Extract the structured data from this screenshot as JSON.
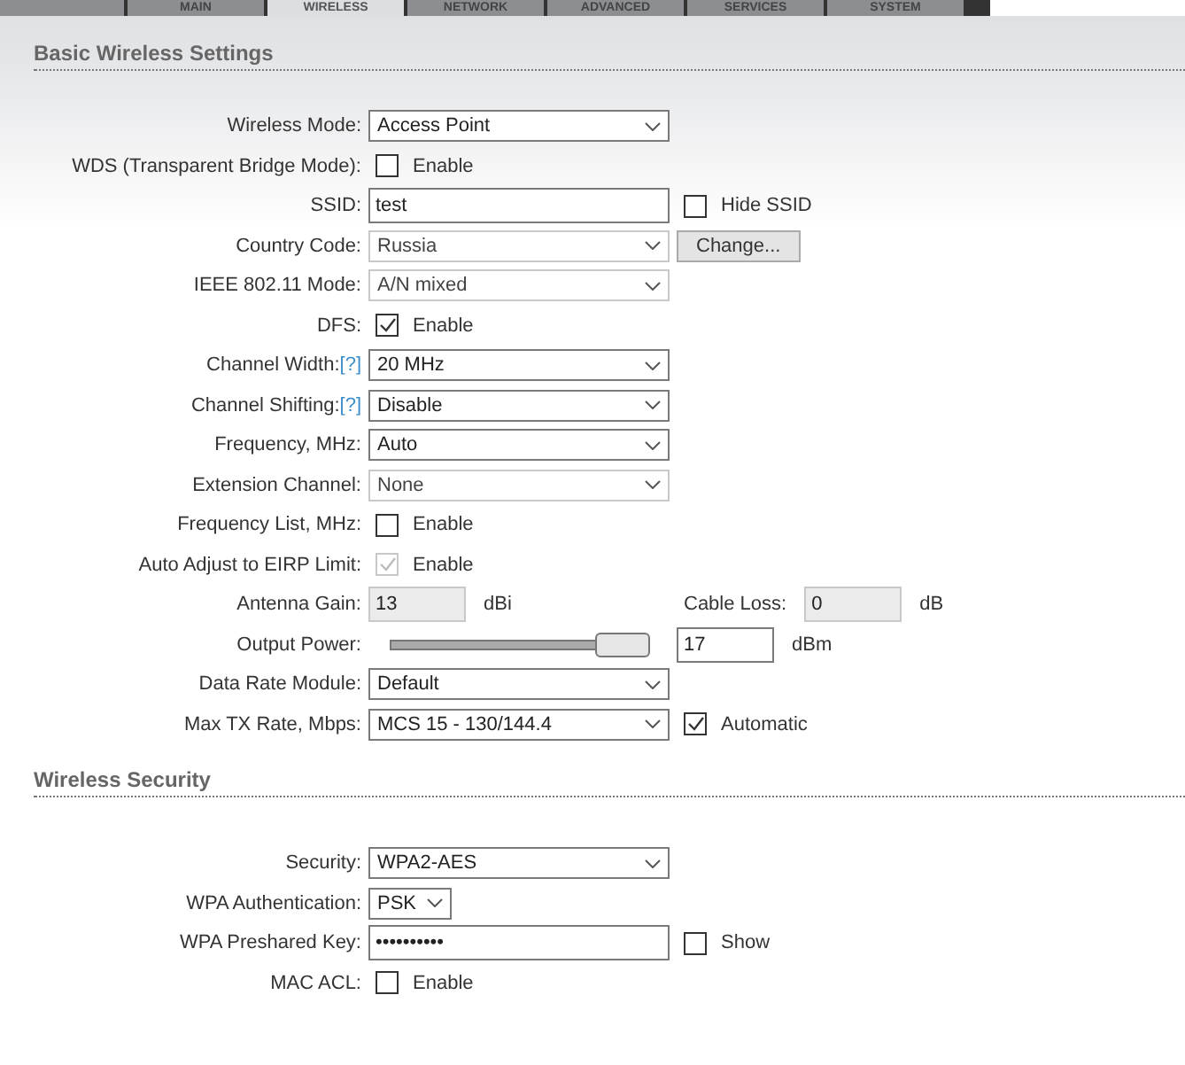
{
  "tabs": [
    {
      "kind": "icon",
      "selected": false
    },
    {
      "kind": "text",
      "label": "MAIN",
      "selected": false
    },
    {
      "kind": "text",
      "label": "WIRELESS",
      "selected": true
    },
    {
      "kind": "text",
      "label": "NETWORK",
      "selected": false
    },
    {
      "kind": "text",
      "label": "ADVANCED",
      "selected": false
    },
    {
      "kind": "text",
      "label": "SERVICES",
      "selected": false
    },
    {
      "kind": "text",
      "label": "SYSTEM",
      "selected": false
    }
  ],
  "sections": [
    {
      "title": "Basic Wireless Settings",
      "rows": [
        {
          "label": "Wireless Mode:",
          "main": [
            {
              "kind": "select",
              "value": "Access Point",
              "disabled": false
            }
          ]
        },
        {
          "label": "WDS (Transparent Bridge Mode):",
          "main": [
            {
              "kind": "checkbox",
              "checked": false,
              "disabled": false,
              "label": "Enable"
            }
          ]
        },
        {
          "label": "SSID:",
          "main": [
            {
              "kind": "input",
              "value": "test",
              "disabled": false
            }
          ],
          "side": [
            {
              "kind": "checkbox",
              "checked": false,
              "disabled": false,
              "label": "Hide SSID"
            }
          ]
        },
        {
          "label": "Country Code:",
          "main": [
            {
              "kind": "select",
              "value": "Russia",
              "disabled": true
            }
          ],
          "side": [
            {
              "kind": "button",
              "label": "Change..."
            }
          ]
        },
        {
          "label": "IEEE 802.11 Mode:",
          "main": [
            {
              "kind": "select",
              "value": "A/N mixed",
              "disabled": true
            }
          ]
        },
        {
          "label": "DFS:",
          "main": [
            {
              "kind": "checkbox",
              "checked": true,
              "disabled": false,
              "label": "Enable"
            }
          ]
        },
        {
          "label": "Channel Width:",
          "help": "[?]",
          "main": [
            {
              "kind": "select",
              "value": "20 MHz",
              "disabled": false
            }
          ]
        },
        {
          "label": "Channel Shifting:",
          "help": "[?]",
          "main": [
            {
              "kind": "select",
              "value": "Disable",
              "disabled": false
            }
          ]
        },
        {
          "label": "Frequency, MHz:",
          "main": [
            {
              "kind": "select",
              "value": "Auto",
              "disabled": false
            }
          ]
        },
        {
          "label": "Extension Channel:",
          "main": [
            {
              "kind": "select",
              "value": "None",
              "disabled": true
            }
          ]
        },
        {
          "label": "Frequency List, MHz:",
          "main": [
            {
              "kind": "checkbox",
              "checked": false,
              "disabled": false,
              "label": "Enable"
            }
          ]
        },
        {
          "label": "Auto Adjust to EIRP Limit:",
          "main": [
            {
              "kind": "checkbox",
              "checked": true,
              "disabled": true,
              "label": "Enable"
            }
          ]
        },
        {
          "label": "Antenna Gain:",
          "main": [
            {
              "kind": "short-input",
              "value": "13",
              "disabled": true
            },
            {
              "kind": "unit",
              "text": "dBi"
            }
          ],
          "side": [
            {
              "kind": "unit",
              "text": "Cable Loss:"
            },
            {
              "kind": "short-input",
              "value": "0",
              "disabled": true
            },
            {
              "kind": "unit",
              "text": "dB"
            }
          ]
        },
        {
          "label": "Output Power:",
          "main": [
            {
              "kind": "slider",
              "level": 0.9
            }
          ],
          "side": [
            {
              "kind": "short-input",
              "value": "17",
              "disabled": false
            },
            {
              "kind": "unit",
              "text": "dBm"
            }
          ]
        },
        {
          "label": "Data Rate Module:",
          "main": [
            {
              "kind": "select",
              "value": "Default",
              "disabled": false
            }
          ]
        },
        {
          "label": "Max TX Rate, Mbps:",
          "main": [
            {
              "kind": "select",
              "value": "MCS 15 - 130/144.4",
              "disabled": false
            }
          ],
          "side": [
            {
              "kind": "checkbox",
              "checked": true,
              "disabled": false,
              "label": "Automatic"
            }
          ]
        }
      ]
    },
    {
      "title": "Wireless Security",
      "rows": [
        {
          "label": "Security:",
          "main": [
            {
              "kind": "select",
              "value": "WPA2-AES",
              "disabled": false
            }
          ]
        },
        {
          "label": "WPA Authentication:",
          "main": [
            {
              "kind": "short-select",
              "value": "PSK",
              "disabled": false
            }
          ]
        },
        {
          "label": "WPA Preshared Key:",
          "main": [
            {
              "kind": "input",
              "value": "••••••••••",
              "disabled": false
            }
          ],
          "side": [
            {
              "kind": "checkbox",
              "checked": false,
              "disabled": false,
              "label": "Show"
            }
          ]
        },
        {
          "label": "MAC ACL:",
          "main": [
            {
              "kind": "checkbox",
              "checked": false,
              "disabled": false,
              "label": "Enable"
            }
          ]
        }
      ]
    }
  ]
}
